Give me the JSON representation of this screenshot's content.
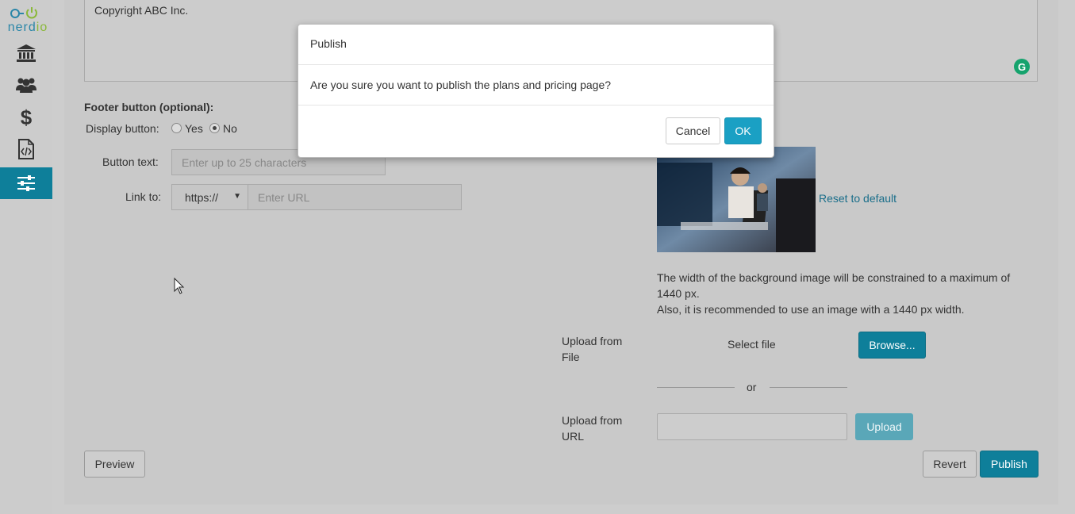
{
  "sidebar": {
    "logo_text_a": "nerd",
    "logo_text_b": "io",
    "items": [
      {
        "icon": "bank-icon"
      },
      {
        "icon": "users-icon"
      },
      {
        "icon": "dollar-icon"
      },
      {
        "icon": "code-file-icon"
      },
      {
        "icon": "sliders-icon",
        "active": true
      }
    ]
  },
  "editor": {
    "copyright_text": "Copyright ABC Inc.",
    "grammarly_glyph": "G"
  },
  "footer_button": {
    "heading": "Footer button (optional):",
    "display_label": "Display button:",
    "yes_label": "Yes",
    "no_label": "No",
    "selected": "No",
    "button_text_label": "Button text:",
    "button_text_placeholder": "Enter up to 25 characters",
    "link_label": "Link to:",
    "protocol_value": "https://",
    "url_placeholder": "Enter URL"
  },
  "background_image": {
    "reset_label": "Reset to default",
    "note_line1": "The width of the background image will be constrained to a maximum of",
    "note_line2": "1440 px.",
    "note_line3": "Also, it is recommended to use an image with a 1440 px width.",
    "upload_file_label_1": "Upload from",
    "upload_file_label_2": "File",
    "select_file_text": "Select file",
    "browse_label": "Browse...",
    "or_text": "or",
    "upload_url_label_1": "Upload from",
    "upload_url_label_2": "URL",
    "upload_button": "Upload"
  },
  "actions": {
    "preview": "Preview",
    "revert": "Revert",
    "publish": "Publish"
  },
  "modal": {
    "title": "Publish",
    "message": "Are you sure you want to publish the plans and pricing page?",
    "cancel": "Cancel",
    "ok": "OK"
  },
  "colors": {
    "primary": "#0e7f9a",
    "ok_button": "#1aa0c4",
    "logo_blue": "#2a86a8",
    "logo_green": "#8ab83a"
  }
}
